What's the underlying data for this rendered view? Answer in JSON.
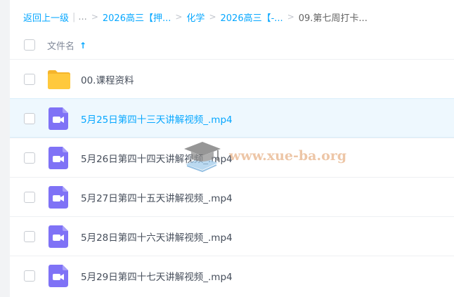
{
  "breadcrumb": {
    "back": "返回上一级",
    "pipe": "|",
    "ellipsis": "...",
    "sep": ">",
    "items": [
      "2026高三【押...",
      "化学",
      "2026高三【-..."
    ],
    "current": "09.第七周打卡..."
  },
  "header": {
    "file_name_label": "文件名",
    "sort_arrow": "↑"
  },
  "files": [
    {
      "name": "00.课程资料",
      "type": "folder-icon",
      "selected": false
    },
    {
      "name": "5月25日第四十三天讲解视频_.mp4",
      "type": "video-file-icon",
      "selected": true
    },
    {
      "name": "5月26日第四十四天讲解视频_.mp4",
      "type": "video-file-icon",
      "selected": false
    },
    {
      "name": "5月27日第四十五天讲解视频_.mp4",
      "type": "video-file-icon",
      "selected": false
    },
    {
      "name": "5月28日第四十六天讲解视频_.mp4",
      "type": "video-file-icon",
      "selected": false
    },
    {
      "name": "5月29日第四十七天讲解视频_.mp4",
      "type": "video-file-icon",
      "selected": false
    }
  ],
  "watermark": {
    "text": "www.xue-ba.org"
  },
  "colors": {
    "accent": "#06a7ff",
    "folder": "#ffc93d",
    "video": "#7f72f6",
    "selected_row": "#eef8fe"
  }
}
